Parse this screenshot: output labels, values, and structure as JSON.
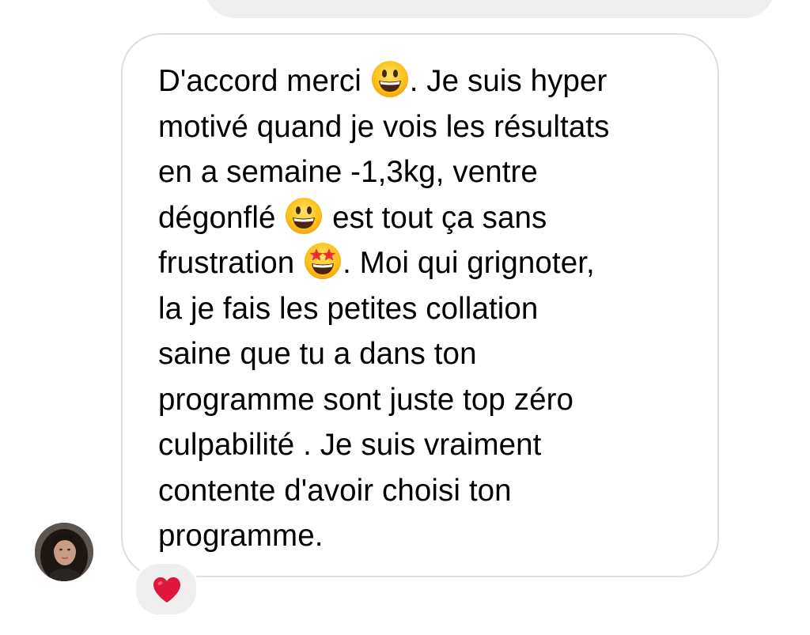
{
  "conversation": {
    "previous_message": {
      "sender": "me"
    },
    "message": {
      "sender": "contact",
      "lines": [
        [
          "D'accord merci ",
          ". Je suis hyper"
        ],
        [
          "motivé quand je vois les résultats"
        ],
        [
          "en a semaine -1,3kg, ventre"
        ],
        [
          "dégonflé ",
          " est tout ça sans"
        ],
        [
          "frustration ",
          ". Moi qui grignoter,"
        ],
        [
          "la je fais les petites collation"
        ],
        [
          "saine que tu a dans ton"
        ],
        [
          "programme sont juste top zéro"
        ],
        [
          "culpabilité . Je suis vraiment"
        ],
        [
          "contente d'avoir choisi ton"
        ],
        [
          "programme."
        ]
      ],
      "emojis": {
        "first": "grinning-face-emoji",
        "second": "grinning-face-emoji",
        "third": "star-struck-emoji"
      }
    },
    "reaction": {
      "icon": "red-heart-emoji",
      "color": "#e0163c"
    },
    "avatar": {
      "icon": "contact-profile-photo"
    }
  },
  "colors": {
    "bubble_border": "#dedede",
    "previous_bubble": "#efefef",
    "reaction_bg": "#efefef",
    "text": "#000000"
  }
}
